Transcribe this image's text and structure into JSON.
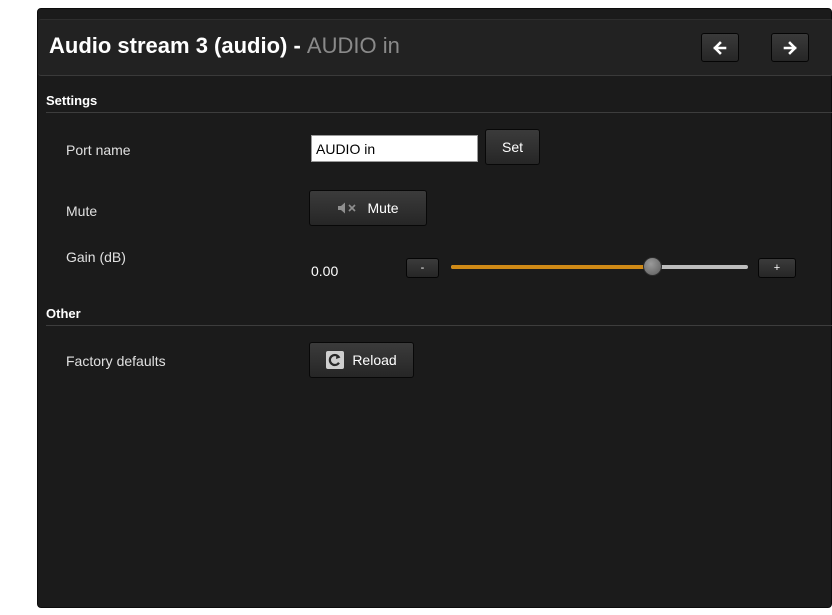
{
  "header": {
    "title": "Audio stream 3 (audio)",
    "separator": " - ",
    "subtitle": "AUDIO in",
    "prev_icon": "arrow-left-icon",
    "next_icon": "arrow-right-icon"
  },
  "settings": {
    "section_title": "Settings",
    "port_name": {
      "label": "Port name",
      "value": "AUDIO in",
      "set_label": "Set"
    },
    "mute": {
      "label": "Mute",
      "button_label": "Mute",
      "icon": "speaker-muted-icon"
    },
    "gain": {
      "label": "Gain (dB)",
      "value": "0.00",
      "minus_label": "-",
      "plus_label": "+",
      "level": 0.68
    }
  },
  "other": {
    "section_title": "Other",
    "factory_defaults": {
      "label": "Factory defaults",
      "button_label": "Reload",
      "icon": "reload-icon"
    }
  },
  "colors": {
    "panel_bg": "#1b1b1b",
    "accent": "#d08a16",
    "subtitle": "#8a8a8a"
  }
}
